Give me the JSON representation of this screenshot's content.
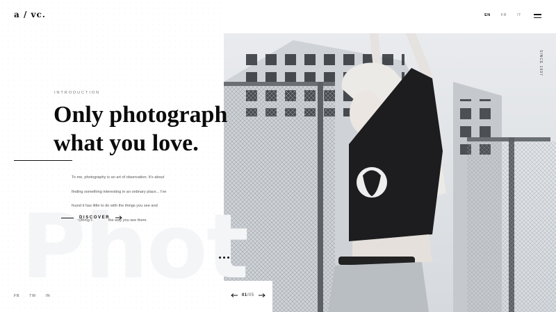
{
  "brand": {
    "logo": "a / vc."
  },
  "header": {
    "languages": [
      {
        "label": "EN",
        "active": true
      },
      {
        "label": "FR",
        "active": false
      },
      {
        "label": "IT",
        "active": false
      }
    ],
    "menu_icon": "hamburger-menu-icon"
  },
  "hero": {
    "eyebrow": "INTRODUCTION",
    "headline": "Only photograph\nwhat you love.",
    "paragraph": "To me, photography is an art of observation. It's about finding something interesting in an ordinary place... I've found it has little to do with the things you see and everything to do with the way you see them.",
    "cta": "DISCOVER",
    "background_word": "Phot",
    "since": "SINCE 1997"
  },
  "socials": [
    "FB",
    "TW",
    "IN"
  ],
  "pager": {
    "current": "01",
    "total": "05",
    "separator": "/"
  },
  "colors": {
    "text": "#111111",
    "muted": "#777777",
    "watermark": "#f3f5f7"
  }
}
